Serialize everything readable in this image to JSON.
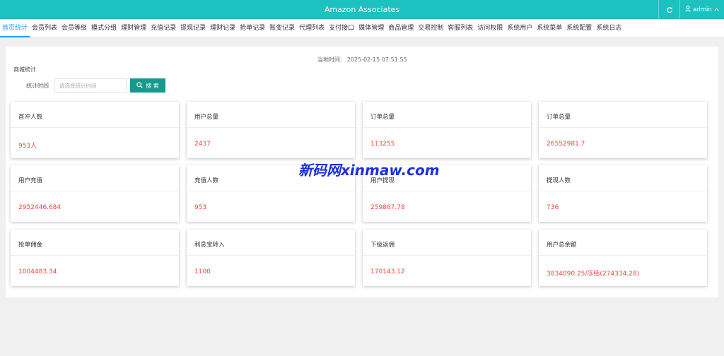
{
  "header": {
    "title": "Amazon Associates",
    "user_label": "admin",
    "refresh_icon": "refresh-icon",
    "user_icon": "user-icon",
    "caret_icon": "chevron-up-icon",
    "color": "#1cc2c0"
  },
  "nav": {
    "items": [
      "首页统计",
      "会员列表",
      "会员等级",
      "模式分组",
      "理财管理",
      "充值记录",
      "提现记录",
      "理财记录",
      "抢单记录",
      "账变记录",
      "代理列表",
      "支付接口",
      "媒体管理",
      "商品管理",
      "交易控制",
      "客服列表",
      "访问权限",
      "系统用户",
      "系统菜单",
      "系统配置",
      "系统日志"
    ],
    "active_index": 0,
    "active_color": "#1e9fff"
  },
  "main": {
    "time_label": "当地时间:",
    "time_value": "2025-02-15 07:51:55",
    "section_title": "商城统计",
    "filter_label": "统计时间",
    "filter_placeholder": "请选择统计时间",
    "search_label": "搜 索",
    "search_icon": "search-icon",
    "value_color": "#ff3f3f"
  },
  "cards": [
    {
      "title": "首冲人数",
      "value": "953人"
    },
    {
      "title": "用户总量",
      "value": "2437"
    },
    {
      "title": "订单总量",
      "value": "113255"
    },
    {
      "title": "订单总量",
      "value": "26552981.7"
    },
    {
      "title": "用户充值",
      "value": "2952446.684"
    },
    {
      "title": "充值人数",
      "value": "953"
    },
    {
      "title": "用户提现",
      "value": "259867.78"
    },
    {
      "title": "提现人数",
      "value": "736"
    },
    {
      "title": "抢单佣金",
      "value": "1004483.34"
    },
    {
      "title": "利息宝转入",
      "value": "1100"
    },
    {
      "title": "下级返佣",
      "value": "170143.12"
    },
    {
      "title": "用户总余额",
      "value": "3834090.25/冻结(274334.28)"
    }
  ],
  "watermark": "新码网xinmaw.com"
}
